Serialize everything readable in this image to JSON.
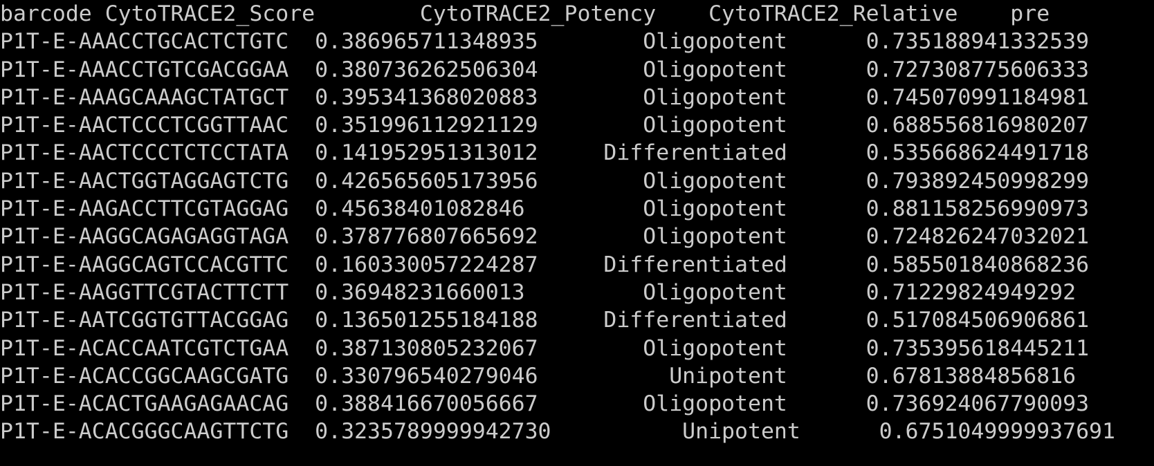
{
  "terminal": {
    "background_color": "#000000",
    "text_color": "#cccccc",
    "columns": [
      {
        "key": "barcode",
        "label": "barcode"
      },
      {
        "key": "score",
        "label": "CytoTRACE2_Score"
      },
      {
        "key": "potency",
        "label": "CytoTRACE2_Potency"
      },
      {
        "key": "relative",
        "label": "CytoTRACE2_Relative"
      },
      {
        "key": "pre",
        "label": "pre"
      }
    ],
    "header_line": "barcode CytoTRACE2_Score        CytoTRACE2_Potency    CytoTRACE2_Relative    pre",
    "rows": [
      {
        "barcode": "P1T-E-AAACCTGCACTCTGTC",
        "score": "0.386965711348935",
        "potency": "Oligopotent",
        "relative": "0.735188941332539",
        "line": "P1T-E-AAACCTGCACTCTGTC  0.386965711348935        Oligopotent      0.735188941332539"
      },
      {
        "barcode": "P1T-E-AAACCTGTCGACGGAA",
        "score": "0.380736262506304",
        "potency": "Oligopotent",
        "relative": "0.727308775606333",
        "line": "P1T-E-AAACCTGTCGACGGAA  0.380736262506304        Oligopotent      0.727308775606333"
      },
      {
        "barcode": "P1T-E-AAAGCAAAGCTATGCT",
        "score": "0.395341368020883",
        "potency": "Oligopotent",
        "relative": "0.745070991184981",
        "line": "P1T-E-AAAGCAAAGCTATGCT  0.395341368020883        Oligopotent      0.745070991184981"
      },
      {
        "barcode": "P1T-E-AACTCCCTCGGTTAAC",
        "score": "0.351996112921129",
        "potency": "Oligopotent",
        "relative": "0.688556816980207",
        "line": "P1T-E-AACTCCCTCGGTTAAC  0.351996112921129        Oligopotent      0.688556816980207"
      },
      {
        "barcode": "P1T-E-AACTCCCTCTCCTATA",
        "score": "0.141952951313012",
        "potency": "Differentiated",
        "relative": "0.535668624491718",
        "line": "P1T-E-AACTCCCTCTCCTATA  0.141952951313012     Differentiated      0.535668624491718"
      },
      {
        "barcode": "P1T-E-AACTGGTAGGAGTCTG",
        "score": "0.426565605173956",
        "potency": "Oligopotent",
        "relative": "0.793892450998299",
        "line": "P1T-E-AACTGGTAGGAGTCTG  0.426565605173956        Oligopotent      0.793892450998299"
      },
      {
        "barcode": "P1T-E-AAGACCTTCGTAGGAG",
        "score": "0.45638401082846",
        "potency": "Oligopotent",
        "relative": "0.881158256990973",
        "line": "P1T-E-AAGACCTTCGTAGGAG  0.45638401082846         Oligopotent      0.881158256990973"
      },
      {
        "barcode": "P1T-E-AAGGCAGAGAGGTAGA",
        "score": "0.378776807665692",
        "potency": "Oligopotent",
        "relative": "0.724826247032021",
        "line": "P1T-E-AAGGCAGAGAGGTAGA  0.378776807665692        Oligopotent      0.724826247032021"
      },
      {
        "barcode": "P1T-E-AAGGCAGTCCACGTTC",
        "score": "0.160330057224287",
        "potency": "Differentiated",
        "relative": "0.585501840868236",
        "line": "P1T-E-AAGGCAGTCCACGTTC  0.160330057224287     Differentiated      0.585501840868236"
      },
      {
        "barcode": "P1T-E-AAGGTTCGTACTTCTT",
        "score": "0.36948231660013",
        "potency": "Oligopotent",
        "relative": "0.71229824949292",
        "line": "P1T-E-AAGGTTCGTACTTCTT  0.36948231660013         Oligopotent      0.71229824949292"
      },
      {
        "barcode": "P1T-E-AATCGGTGTTACGGAG",
        "score": "0.136501255184188",
        "potency": "Differentiated",
        "relative": "0.517084506906861",
        "line": "P1T-E-AATCGGTGTTACGGAG  0.136501255184188     Differentiated      0.517084506906861"
      },
      {
        "barcode": "P1T-E-ACACCAATCGTCTGAA",
        "score": "0.387130805232067",
        "potency": "Oligopotent",
        "relative": "0.735395618445211",
        "line": "P1T-E-ACACCAATCGTCTGAA  0.387130805232067        Oligopotent      0.735395618445211"
      },
      {
        "barcode": "P1T-E-ACACCGGCAAGCGATG",
        "score": "0.330796540279046",
        "potency": "Unipotent",
        "relative": "0.67813884856816",
        "line": "P1T-E-ACACCGGCAAGCGATG  0.330796540279046          Unipotent      0.67813884856816"
      },
      {
        "barcode": "P1T-E-ACACTGAAGAGAACAG",
        "score": "0.388416670056667",
        "potency": "Oligopotent",
        "relative": "0.736924067790093",
        "line": "P1T-E-ACACTGAAGAGAACAG  0.388416670056667        Oligopotent      0.736924067790093"
      }
    ],
    "clipped_last_line": "P1T-E-ACACGGGCAAGTTCTG  0.3235789999942730          Unipotent      0.6751049999937691"
  }
}
